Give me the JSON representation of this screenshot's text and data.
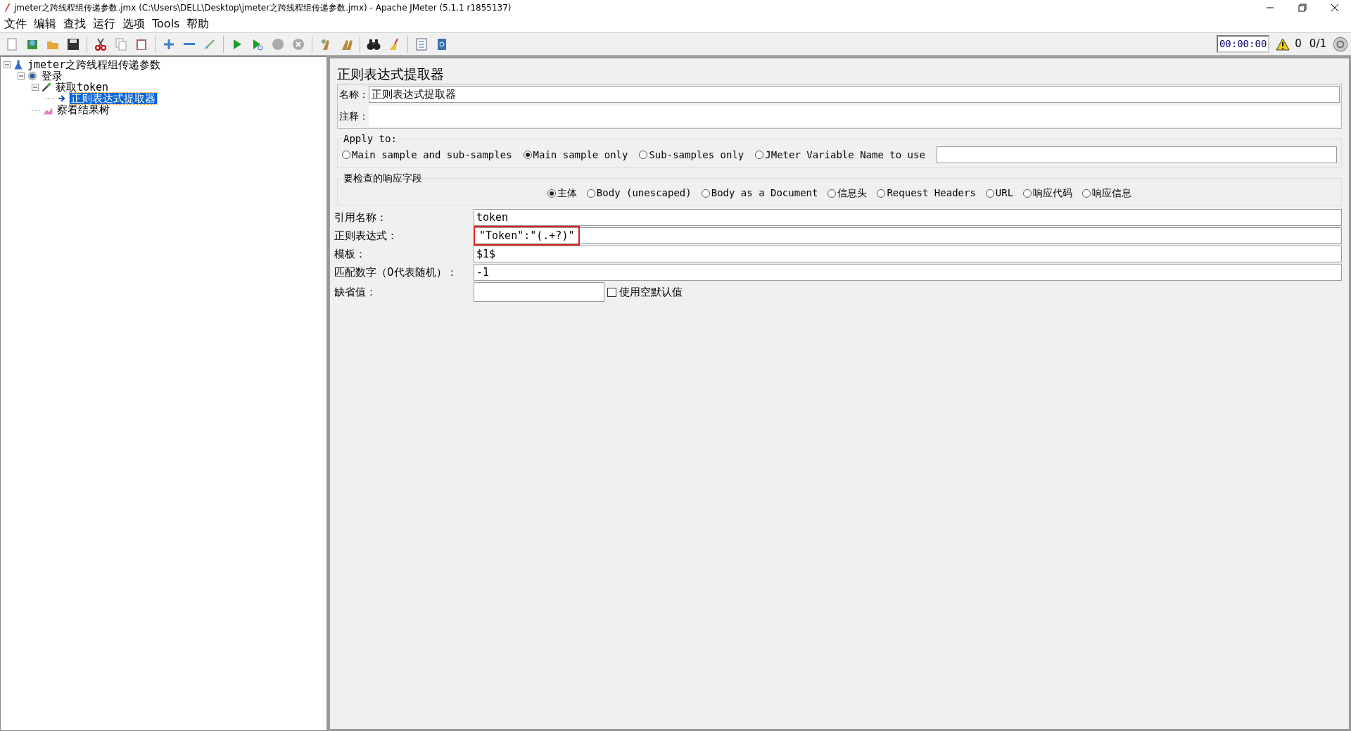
{
  "window": {
    "title": "jmeter之跨线程组传递参数.jmx (C:\\Users\\DELL\\Desktop\\jmeter之跨线程组传递参数.jmx) - Apache JMeter (5.1.1 r1855137)"
  },
  "menu": [
    "文件",
    "编辑",
    "查找",
    "运行",
    "选项",
    "Tools",
    "帮助"
  ],
  "status": {
    "timer": "00:00:00",
    "warnings": "0",
    "threads": "0/1"
  },
  "tree": [
    {
      "label": "jmeter之跨线程组传递参数",
      "kind": "plan",
      "expanded": true,
      "selected": false,
      "children": [
        {
          "label": "登录",
          "kind": "thread",
          "expanded": true,
          "selected": false,
          "children": [
            {
              "label": "获取token",
              "kind": "sampler",
              "expanded": true,
              "selected": false,
              "children": [
                {
                  "label": "正则表达式提取器",
                  "kind": "extractor",
                  "selected": true
                }
              ]
            },
            {
              "label": "察看结果树",
              "kind": "listener",
              "selected": false
            }
          ]
        }
      ]
    }
  ],
  "panel": {
    "title": "正则表达式提取器",
    "name_label": "名称：",
    "name_value": "正则表达式提取器",
    "comment_label": "注释："
  },
  "apply_to": {
    "legend": "Apply to:",
    "options": [
      {
        "label": "Main sample and sub-samples",
        "selected": false
      },
      {
        "label": "Main sample only",
        "selected": true
      },
      {
        "label": "Sub-samples only",
        "selected": false
      },
      {
        "label": "JMeter Variable Name to use",
        "selected": false
      }
    ]
  },
  "field_to_check": {
    "legend": "要检查的响应字段",
    "options": [
      {
        "label": "主体",
        "selected": true
      },
      {
        "label": "Body (unescaped)",
        "selected": false
      },
      {
        "label": "Body as a Document",
        "selected": false
      },
      {
        "label": "信息头",
        "selected": false
      },
      {
        "label": "Request Headers",
        "selected": false
      },
      {
        "label": "URL",
        "selected": false
      },
      {
        "label": "响应代码",
        "selected": false
      },
      {
        "label": "响应信息",
        "selected": false
      }
    ]
  },
  "fields": [
    {
      "label": "引用名称：",
      "value": "token",
      "highlighted": false
    },
    {
      "label": "正则表达式：",
      "value": "\"Token\":\"(.+?)\"",
      "highlighted": true
    },
    {
      "label": "模板：",
      "value": "$1$",
      "highlighted": false
    },
    {
      "label": "匹配数字（0代表随机）：",
      "value": "-1",
      "highlighted": false
    }
  ],
  "default_value": {
    "label": "缺省值：",
    "checkbox_label": "使用空默认值",
    "checked": false
  }
}
